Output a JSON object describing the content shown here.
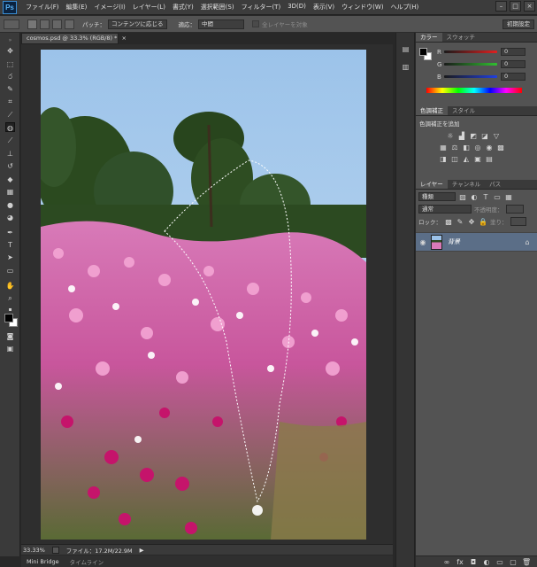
{
  "app": {
    "logo": "Ps"
  },
  "menubar": {
    "items": [
      "ファイル(F)",
      "編集(E)",
      "イメージ(I)",
      "レイヤー(L)",
      "書式(Y)",
      "選択範囲(S)",
      "フィルター(T)",
      "3D(D)",
      "表示(V)",
      "ウィンドウ(W)",
      "ヘルプ(H)"
    ],
    "window_controls": [
      "–",
      "□",
      "×"
    ]
  },
  "options_bar": {
    "patch_label": "パッチ：",
    "patch_value": "コンテンツに応じる",
    "adapt_label": "適応：",
    "adapt_value": "中間",
    "sample_all_layers": "全レイヤーを対象",
    "initial_workspace": "初期設定"
  },
  "document": {
    "tab_title": "cosmos.psd @ 33.3% (RGB/8) *",
    "tab_close": "×"
  },
  "statusbar": {
    "zoom": "33.33%",
    "file_info": "ファイル：17.2M/22.9M",
    "arrow": "▶"
  },
  "bottom_tabs": [
    "Mini Bridge",
    "タイムライン"
  ],
  "color_panel": {
    "tabs": [
      "カラー",
      "スウォッチ"
    ],
    "channels": [
      {
        "label": "R",
        "value": "0",
        "color": "#c8202a"
      },
      {
        "label": "G",
        "value": "0",
        "color": "#2fa22f"
      },
      {
        "label": "B",
        "value": "0",
        "color": "#2a3fb8"
      }
    ]
  },
  "adjustments_panel": {
    "tabs": [
      "色調補正",
      "スタイル"
    ],
    "add_label": "色調補正を追加"
  },
  "layers_panel": {
    "tabs": [
      "レイヤー",
      "チャンネル",
      "パス"
    ],
    "filter_kind": "種類",
    "blend_mode": "通常",
    "opacity_label": "不透明度：",
    "lock_label": "ロック：",
    "fill_label": "塗り：",
    "layer_name": "背景"
  },
  "colors": {
    "menubar_bg": "#3c3c3c",
    "panel_bg": "#535353",
    "selected_layer": "#5b6e87"
  }
}
